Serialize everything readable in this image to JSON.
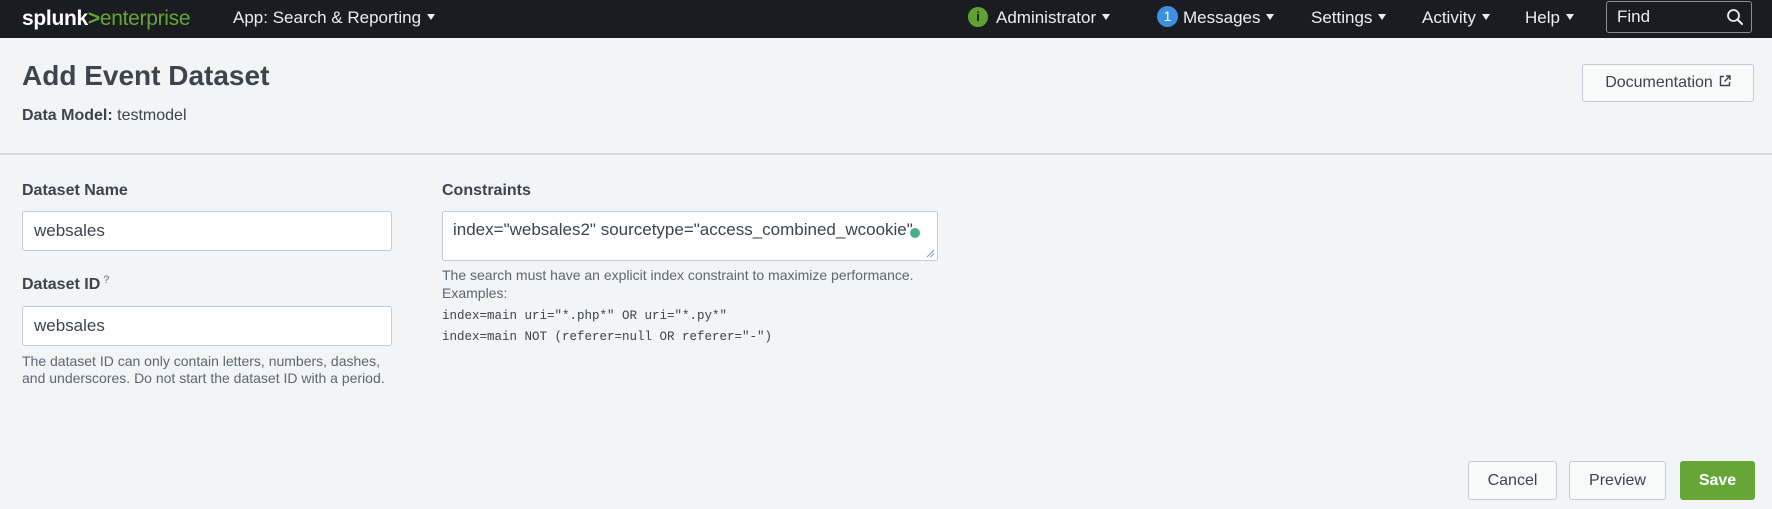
{
  "nav": {
    "logo_brand": "splunk",
    "logo_gt": ">",
    "logo_product": "enterprise",
    "app_label": "App: Search & Reporting",
    "status_symbol": "i",
    "user_label": "Administrator",
    "messages_count": "1",
    "messages_label": "Messages",
    "settings_label": "Settings",
    "activity_label": "Activity",
    "help_label": "Help",
    "find_placeholder": "Find"
  },
  "header": {
    "title": "Add Event Dataset",
    "data_model_label": "Data Model:",
    "data_model_value": "testmodel",
    "documentation_label": "Documentation"
  },
  "form": {
    "dataset_name": {
      "label": "Dataset Name",
      "value": "websales"
    },
    "dataset_id": {
      "label": "Dataset ID",
      "help_mark": "?",
      "value": "websales",
      "help": "The dataset ID can only contain letters, numbers, dashes, and underscores. Do not start the dataset ID with a period."
    },
    "constraints": {
      "label": "Constraints",
      "value": "index=\"websales2\" sourcetype=\"access_combined_wcookie\"",
      "help": "The search must have an explicit index constraint to maximize performance.",
      "examples_label": "Examples:",
      "examples": [
        "index=main uri=\"*.php*\" OR uri=\"*.py*\"",
        "index=main NOT (referer=null OR referer=\"-\")"
      ]
    }
  },
  "footer": {
    "cancel_label": "Cancel",
    "preview_label": "Preview",
    "save_label": "Save"
  },
  "colors": {
    "topbar": "#1a1c21",
    "brand_green": "#65a637",
    "messages_badge": "#3d8fe0",
    "page_background": "#f2f4f5"
  },
  "icons": {
    "status": "info-status-icon",
    "find": "search-icon",
    "documentation": "external-link-icon",
    "menu": "caret-down-icon"
  }
}
